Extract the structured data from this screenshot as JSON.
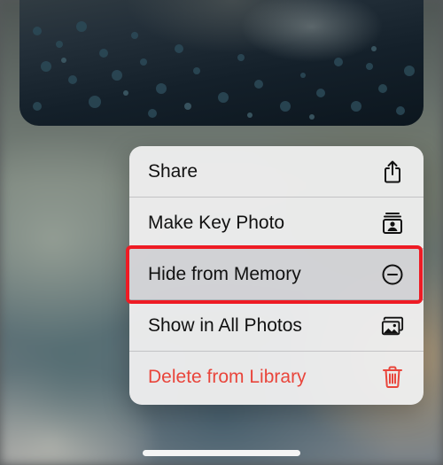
{
  "menu": {
    "items": [
      {
        "label": "Share",
        "icon": "share-icon",
        "danger": false,
        "selected": false
      },
      {
        "label": "Make Key Photo",
        "icon": "key-photo-icon",
        "danger": false,
        "selected": false
      },
      {
        "label": "Hide from Memory",
        "icon": "minus-circle-icon",
        "danger": false,
        "selected": true
      },
      {
        "label": "Show in All Photos",
        "icon": "photos-icon",
        "danger": false,
        "selected": false
      },
      {
        "label": "Delete from Library",
        "icon": "trash-icon",
        "danger": true,
        "selected": false
      }
    ]
  },
  "colors": {
    "destructive": "#e9453b",
    "highlight": "#ee1b24",
    "menu_background": "#eeeeee"
  }
}
